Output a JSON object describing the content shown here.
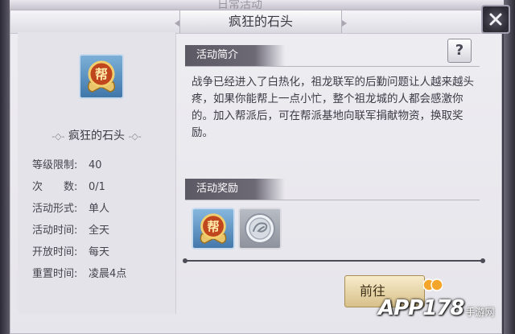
{
  "window": {
    "title": "疯狂的石头",
    "background_title": "日常活动"
  },
  "item": {
    "name": "疯狂的石头",
    "icon": "bang-medal-icon",
    "icon_text": "帮"
  },
  "info": [
    {
      "label": "等级限制:",
      "value": "40"
    },
    {
      "label": "次　　数:",
      "value": "0/1"
    },
    {
      "label": "活动形式:",
      "value": "单人"
    },
    {
      "label": "活动时间:",
      "value": "全天"
    },
    {
      "label": "开放时间:",
      "value": "每天"
    },
    {
      "label": "重置时间:",
      "value": "凌晨4点"
    }
  ],
  "intro": {
    "heading": "活动简介",
    "help_label": "?",
    "text": "战争已经进入了白热化，祖龙联军的后勤问题让人越来越头疼，如果你能帮上一点小忙，整个祖龙城的人都会感激你的。加入帮派后，可在帮派基地向联军捐献物资，换取奖励。"
  },
  "rewards": {
    "heading": "活动奖励",
    "items": [
      {
        "icon": "bang-medal-icon",
        "text": "帮"
      },
      {
        "icon": "silver-dragon-coin-icon"
      }
    ]
  },
  "actions": {
    "go_label": "前往"
  },
  "watermark": {
    "brand": "APP178",
    "sub": "手游网"
  },
  "colors": {
    "panel_bg": "#eeedf2",
    "tab_bg": "#5c5965",
    "gold": "#d8c08a"
  }
}
